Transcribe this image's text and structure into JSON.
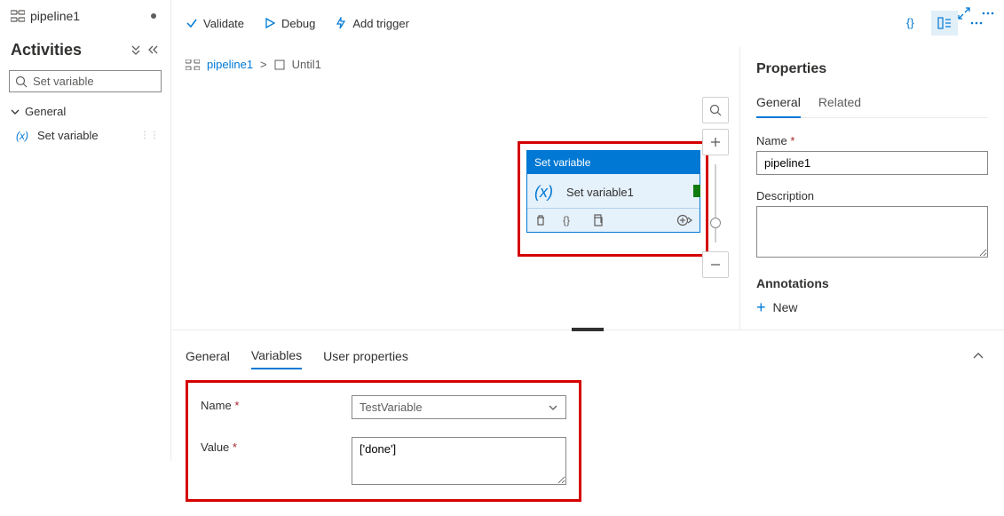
{
  "sidebar": {
    "pipeline_tab": "pipeline1",
    "activities_heading": "Activities",
    "search_placeholder": "Set variable",
    "group_label": "General",
    "item_label": "Set variable"
  },
  "toolbar": {
    "validate": "Validate",
    "debug": "Debug",
    "add_trigger": "Add trigger"
  },
  "breadcrumb": {
    "pipeline": "pipeline1",
    "sep": ">",
    "until": "Until1"
  },
  "activity_card": {
    "type_label": "Set variable",
    "name": "Set variable1"
  },
  "bottom_tabs": {
    "general": "General",
    "variables": "Variables",
    "user_props": "User properties"
  },
  "variables_form": {
    "name_label": "Name",
    "name_value": "TestVariable",
    "value_label": "Value",
    "value_value": "['done']"
  },
  "properties": {
    "title": "Properties",
    "tab_general": "General",
    "tab_related": "Related",
    "name_label": "Name",
    "name_value": "pipeline1",
    "description_label": "Description",
    "description_value": "",
    "annotations_label": "Annotations",
    "new_label": "New"
  }
}
